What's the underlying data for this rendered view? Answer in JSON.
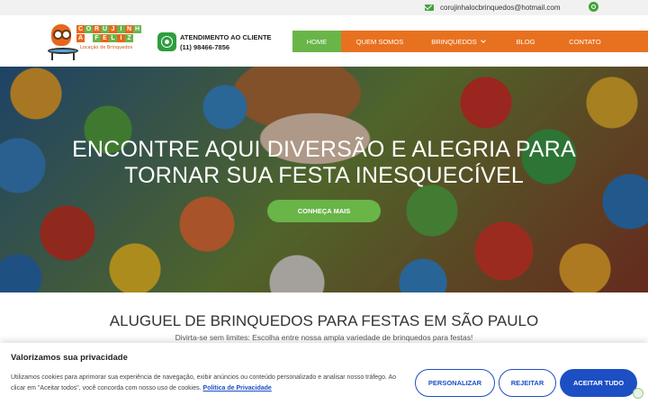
{
  "topbar": {
    "email": "corujinhalocbrinquedos@hotmail.com",
    "email_icon": "envelope-icon",
    "social_icon": "instagram-icon"
  },
  "logo": {
    "letters_row1": [
      "C",
      "O",
      "R",
      "U",
      "J",
      "I",
      "N",
      "H",
      "A"
    ],
    "letters_row2": [
      "F",
      "E",
      "L",
      "I",
      "Z"
    ],
    "subtitle": "Locação de Brinquedos",
    "letter_colors": [
      "#e8661c",
      "#69b548",
      "#e8661c",
      "#69b548",
      "#e8661c",
      "#69b548",
      "#e8661c",
      "#69b548",
      "#e8661c"
    ]
  },
  "contact": {
    "icon": "whatsapp-icon",
    "label": "ATENDIMENTO AO CLIENTE",
    "phone": "(11) 98466-7856"
  },
  "nav": {
    "items": [
      {
        "label": "HOME",
        "active": true
      },
      {
        "label": "QUEM SOMOS",
        "active": false
      },
      {
        "label": "BRINQUEDOS",
        "active": false,
        "dropdown": true
      },
      {
        "label": "BLOG",
        "active": false
      },
      {
        "label": "CONTATO",
        "active": false
      }
    ],
    "colors": {
      "bar": "#e8711f",
      "active": "#69b548"
    }
  },
  "hero": {
    "headline_line1": "ENCONTRE AQUI DIVERSÃO E ALEGRIA PARA",
    "headline_line2": "TORNAR SUA FESTA INESQUECÍVEL",
    "cta_label": "CONHEÇA MAIS"
  },
  "section": {
    "title": "ALUGUEL DE BRINQUEDOS PARA FESTAS EM SÃO PAULO",
    "subtitle": "Divirta-se sem limites: Escolha entre nossa ampla variedade de brinquedos para festas!"
  },
  "cookie_banner": {
    "title": "Valorizamos sua privacidade",
    "text": "Utilizamos cookies para aprimorar sua experiência de navegação, exibir anúncios ou conteúdo personalizado e analisar nosso tráfego. Ao clicar em \"Aceitar todos\", você concorda com nosso uso de cookies.",
    "policy_link": "Política de Privacidade",
    "customize_label": "PERSONALIZAR",
    "reject_label": "REJEITAR",
    "accept_label": "ACEITAR TUDO",
    "accent": "#1c4fc4"
  }
}
